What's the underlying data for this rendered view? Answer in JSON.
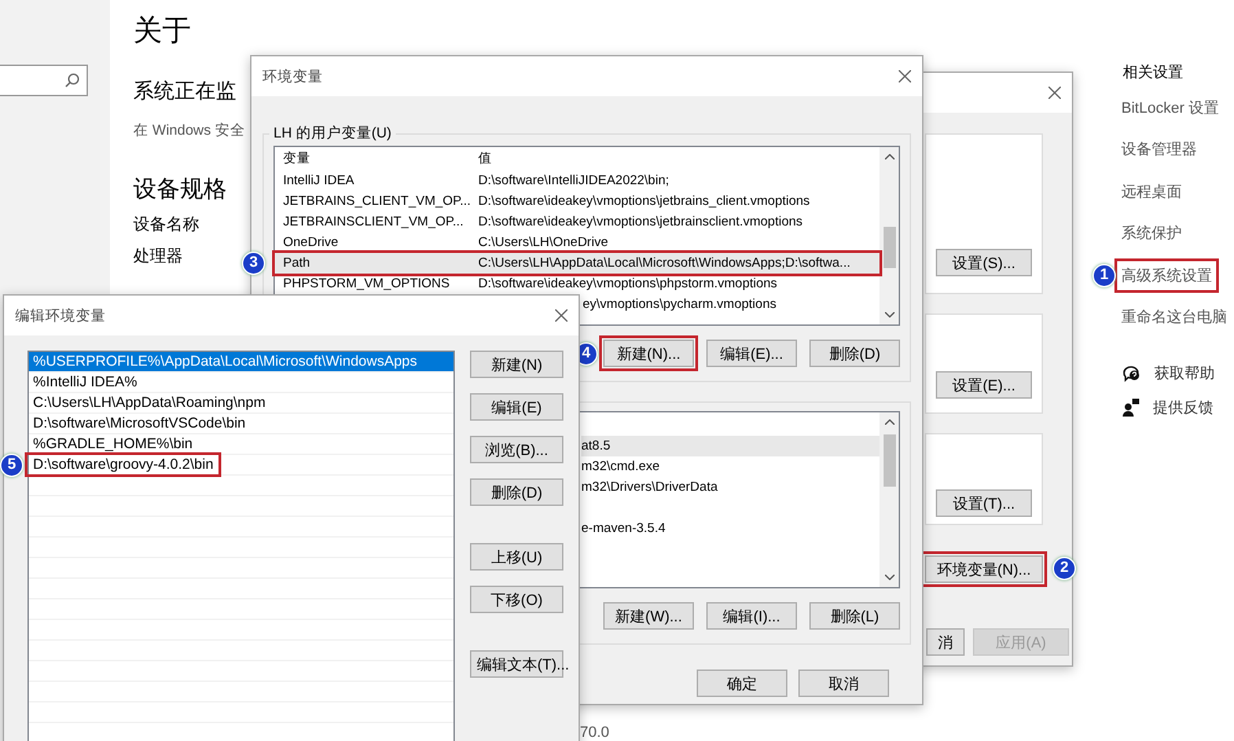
{
  "settings_page": {
    "search": {
      "kind": "search"
    },
    "title": "关于",
    "heading": "系统正在监",
    "note": "在 Windows 安全",
    "specs_title": "设备规格",
    "spec_labels": [
      "设备名称",
      "处理器"
    ],
    "footer_fragment": "70.0",
    "related": {
      "title": "相关设置",
      "links": [
        {
          "label": "BitLocker 设置"
        },
        {
          "label": "设备管理器"
        },
        {
          "label": "远程桌面"
        },
        {
          "label": "系统保护"
        },
        {
          "label": "高级系统设置",
          "step": "1"
        },
        {
          "label": "重命名这台电脑"
        }
      ],
      "support": [
        {
          "kind": "help",
          "label": "获取帮助"
        },
        {
          "kind": "feedback",
          "label": "提供反馈"
        }
      ]
    }
  },
  "system_properties": {
    "group_buttons": [
      {
        "label": "设置(S)..."
      },
      {
        "label": "设置(E)..."
      },
      {
        "label": "设置(T)..."
      }
    ],
    "env_button": {
      "label": "环境变量(N)...",
      "step": "2"
    },
    "footer_buttons": [
      {
        "label": "消",
        "disabled": false
      },
      {
        "label": "应用(A)",
        "disabled": true
      }
    ]
  },
  "env_dialog": {
    "title": "环境变量",
    "user_group": "LH 的用户变量(U)",
    "columns": [
      "变量",
      "值"
    ],
    "user_rows": [
      {
        "kind": "full",
        "name": "IntelliJ IDEA",
        "value": "D:\\software\\IntelliJIDEA2022\\bin;",
        "selected": false
      },
      {
        "kind": "full",
        "name": "JETBRAINS_CLIENT_VM_OP...",
        "value": "D:\\software\\ideakey\\vmoptions\\jetbrains_client.vmoptions",
        "selected": false
      },
      {
        "kind": "full",
        "name": "JETBRAINSCLIENT_VM_OP...",
        "value": "D:\\software\\ideakey\\vmoptions\\jetbrainsclient.vmoptions",
        "selected": false
      },
      {
        "kind": "full",
        "name": "OneDrive",
        "value": "C:\\Users\\LH\\OneDrive",
        "selected": false
      },
      {
        "kind": "full",
        "name": "Path",
        "value": "C:\\Users\\LH\\AppData\\Local\\Microsoft\\WindowsApps;D:\\softwa...",
        "selected": true,
        "step": "3"
      },
      {
        "kind": "full",
        "name": "PHPSTORM_VM_OPTIONS",
        "value": "D:\\software\\ideakey\\vmoptions\\phpstorm.vmoptions",
        "selected": false
      },
      {
        "kind": "partial",
        "value": "ey\\vmoptions\\pycharm.vmoptions",
        "selected": false
      }
    ],
    "user_buttons": [
      {
        "label": "新建(N)...",
        "step": "4"
      },
      {
        "label": "编辑(E)..."
      },
      {
        "label": "删除(D)"
      }
    ],
    "system_rows": [
      {
        "value": "at8.5",
        "selected": true
      },
      {
        "value": "m32\\cmd.exe",
        "selected": false
      },
      {
        "value": "m32\\Drivers\\DriverData",
        "selected": false
      },
      {
        "selected": false
      },
      {
        "value": "e-maven-3.5.4",
        "selected": false
      },
      {
        "selected": false
      }
    ],
    "system_buttons": [
      {
        "label": "新建(W)..."
      },
      {
        "label": "编辑(I)..."
      },
      {
        "label": "删除(L)"
      }
    ],
    "footer_buttons": [
      "确定",
      "取消"
    ]
  },
  "edit_dialog": {
    "title": "编辑环境变量",
    "entries": [
      {
        "text": "%USERPROFILE%\\AppData\\Local\\Microsoft\\WindowsApps",
        "selected": true
      },
      {
        "text": "%IntelliJ IDEA%",
        "selected": false
      },
      {
        "text": "C:\\Users\\LH\\AppData\\Roaming\\npm",
        "selected": false
      },
      {
        "text": "D:\\software\\MicrosoftVSCode\\bin",
        "selected": false
      },
      {
        "text": "%GRADLE_HOME%\\bin",
        "selected": false
      },
      {
        "text": "D:\\software\\groovy-4.0.2\\bin",
        "selected": false,
        "step": "5"
      }
    ],
    "buttons": [
      {
        "label": "新建(N)",
        "kind": "normal"
      },
      {
        "label": "编辑(E)",
        "kind": "normal"
      },
      {
        "label": "浏览(B)...",
        "kind": "normal"
      },
      {
        "label": "删除(D)",
        "kind": "normal"
      },
      {
        "label": "上移(U)",
        "kind": "spaced"
      },
      {
        "label": "下移(O)",
        "kind": "normal"
      },
      {
        "label": "编辑文本(T)...",
        "kind": "spaced"
      }
    ]
  }
}
